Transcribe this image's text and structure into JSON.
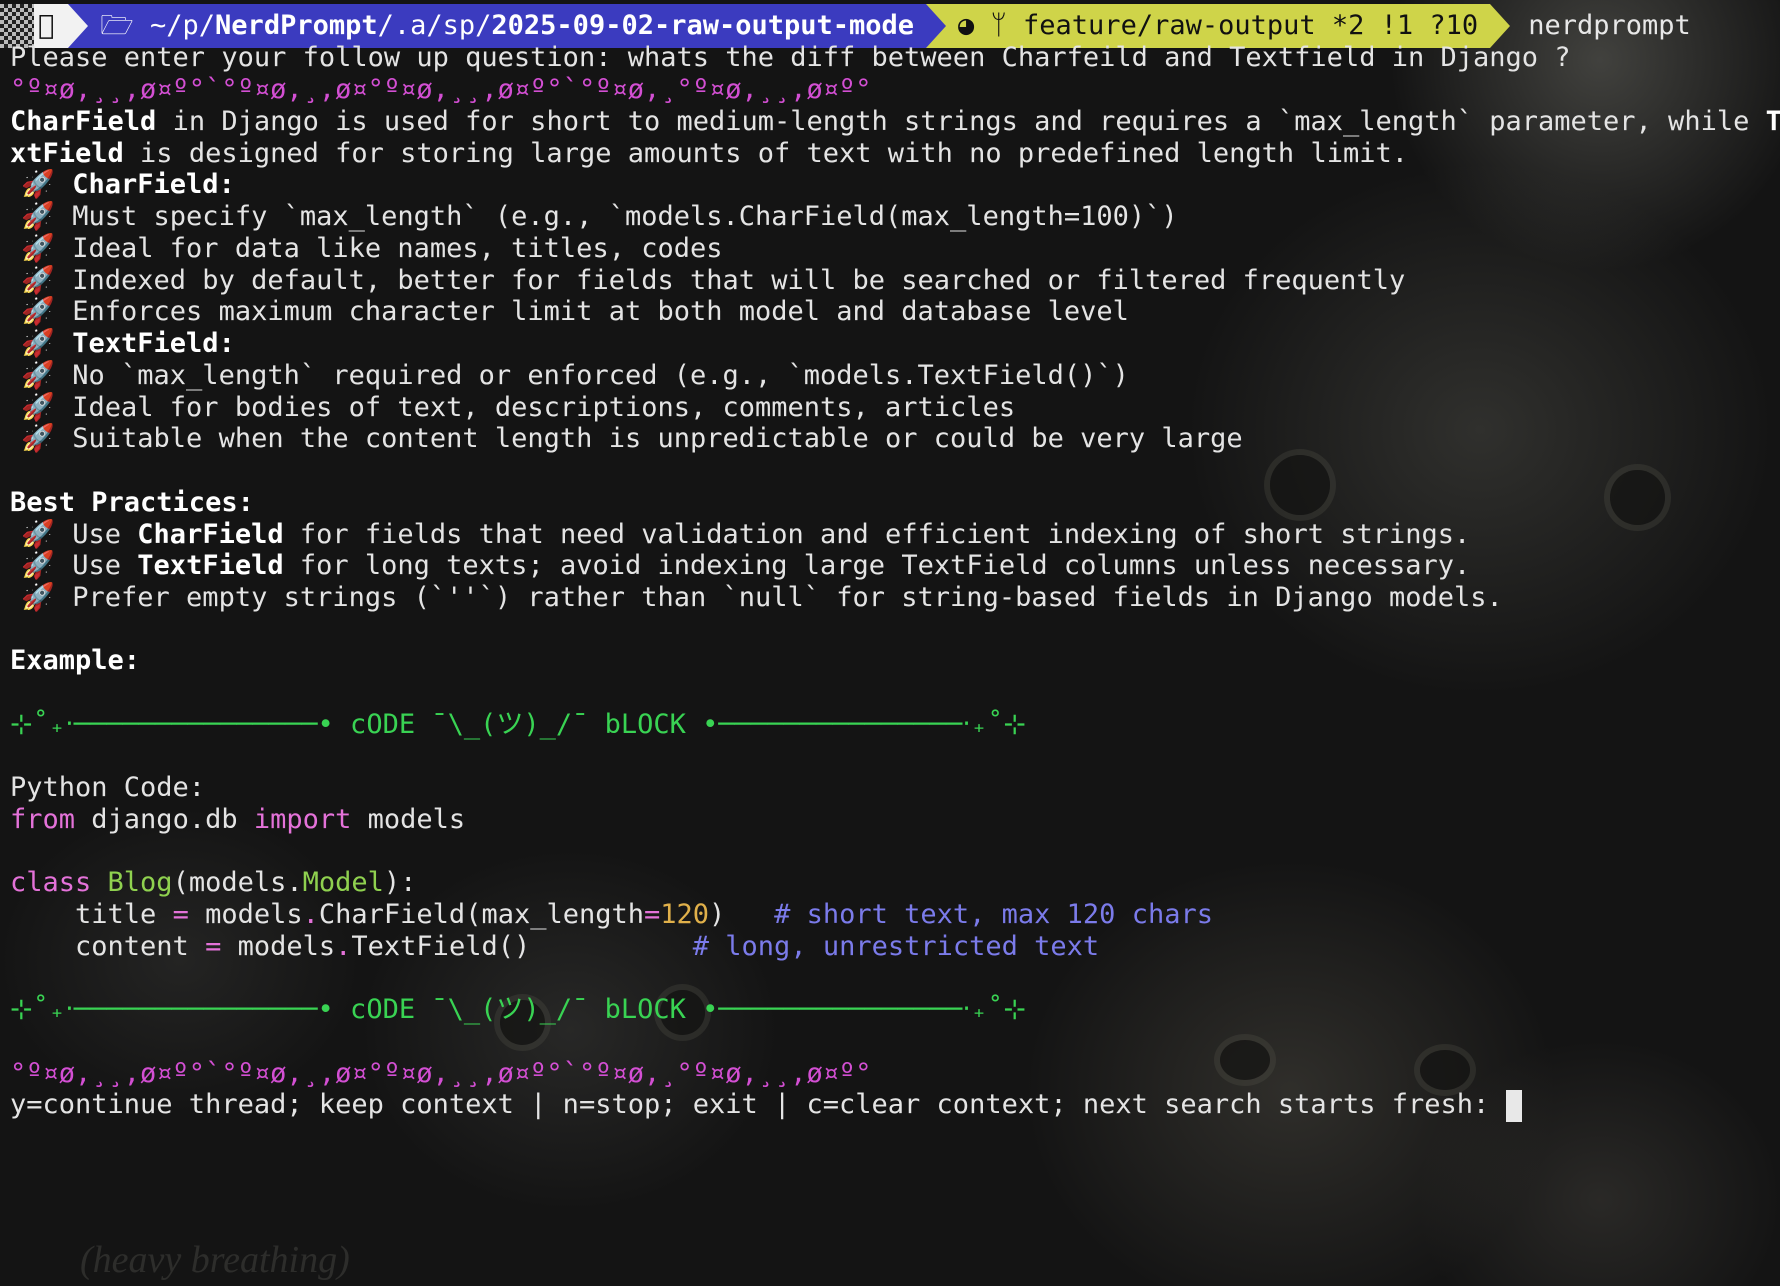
{
  "prompt": {
    "os_icon": "apple-icon",
    "folder_icon": "folder-icon",
    "path_prefix": "~/p/",
    "path_repo": "NerdPrompt",
    "path_mid": "/.a/sp/",
    "path_dir": "2025-09-02-raw-output-mode",
    "git_icon": "github-icon",
    "branch_icon": "branch-icon",
    "branch": "feature/raw-output *2 !1 ?10",
    "user": "nerdprompt"
  },
  "question_line": "Please enter your follow up question: whats the diff between Charfeild and Textfield in Django ?",
  "divider": "°º¤ø,¸¸,ø¤º°`°º¤ø,¸,ø¤°º¤ø,¸¸,ø¤º°`°º¤ø,¸°º¤ø,¸¸,ø¤º°",
  "answer": {
    "l1_a": "CharField",
    "l1_b": " in Django is used for short to medium-length strings and requires a `max_length` parameter, while ",
    "l1_c": "Te",
    "l2_a": "xtField",
    "l2_b": " is designed for storing large amounts of text with no predefined length limit."
  },
  "bullet_icon": "🚀",
  "charfield_heading": "CharField:",
  "charfield_items": [
    "Must specify `max_length` (e.g., `models.CharField(max_length=100)`)",
    "Ideal for data like names, titles, codes",
    "Indexed by default, better for fields that will be searched or filtered frequently",
    "Enforces maximum character limit at both model and database level"
  ],
  "textfield_heading": "TextField:",
  "textfield_items": [
    "No `max_length` required or enforced (e.g., `models.TextField()`)",
    "Ideal for bodies of text, descriptions, comments, articles",
    "Suitable when the content length is unpredictable or could be very large"
  ],
  "best_practices_heading": "Best Practices:",
  "best_practices": [
    {
      "pre": "Use ",
      "bold": "CharField",
      "post": " for fields that need validation and efficient indexing of short strings."
    },
    {
      "pre": "Use ",
      "bold": "TextField",
      "post": " for long texts; avoid indexing large TextField columns unless necessary."
    },
    {
      "pre": "Prefer empty strings (`''`) rather than `null` for string-based fields in Django models.",
      "bold": "",
      "post": ""
    }
  ],
  "example_heading": "Example:",
  "code_banner": "⊹˚₊‧───────────────• cODE ¯\\_(ツ)_/¯ bLOCK •───────────────‧₊˚⊹",
  "code_title": "Python Code:",
  "code": {
    "l1_from": "from",
    "l1_mod": " django.db ",
    "l1_import": "import",
    "l1_rest": " models",
    "l2_class": "class",
    "l2_name": " Blog",
    "l2_rest": "(models.",
    "l2_model": "Model",
    "l2_end": "):",
    "l3_a": "    title ",
    "l3_eq": "=",
    "l3_b": " models",
    "l3_dot": ".",
    "l3_c": "CharField(max_length",
    "l3_eq2": "=",
    "l3_num": "120",
    "l3_d": ")   ",
    "l3_comment": "# short text, max 120 chars",
    "l4_a": "    content ",
    "l4_eq": "=",
    "l4_b": " models",
    "l4_dot": ".",
    "l4_c": "TextField()          ",
    "l4_comment": "# long, unrestricted text"
  },
  "continue_prompt": "y=continue thread; keep context | n=stop; exit | c=clear context; next search starts fresh: ",
  "watermark": "(heavy breathing)"
}
